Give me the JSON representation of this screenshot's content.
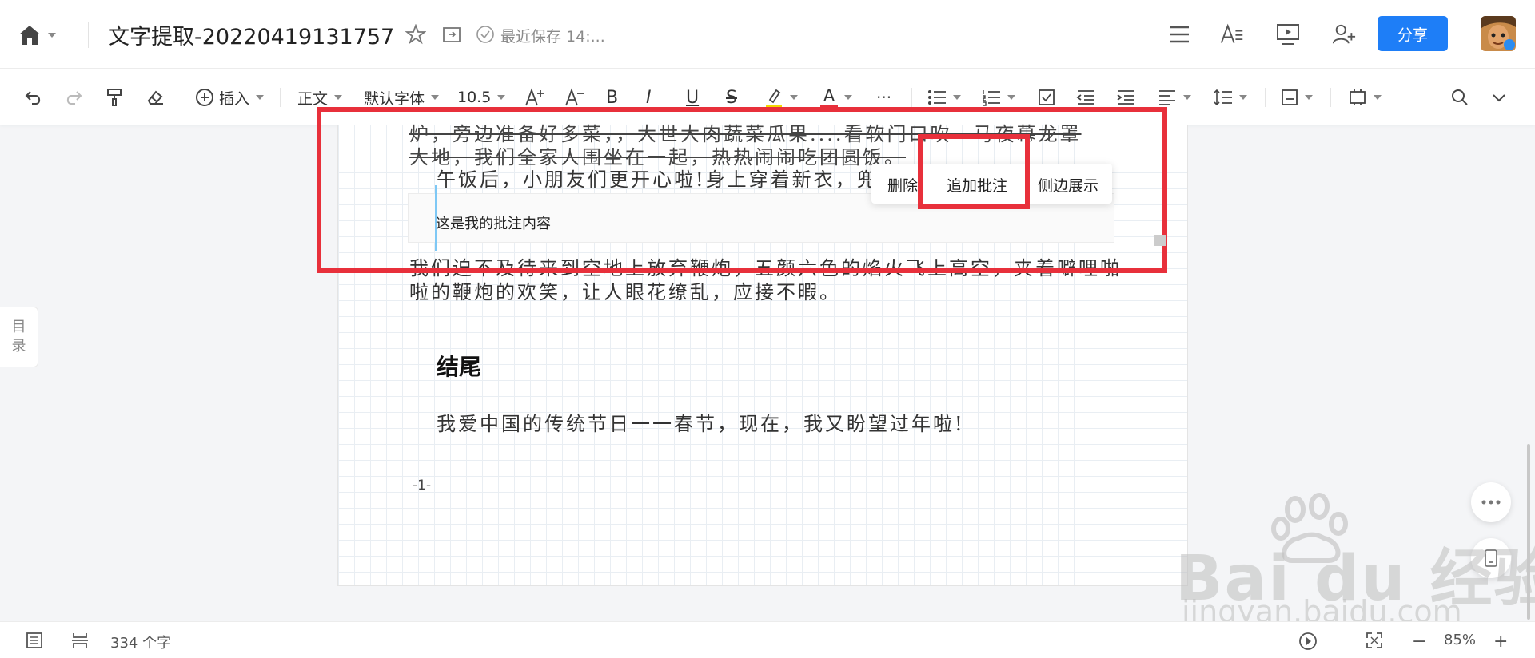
{
  "header": {
    "title": "文字提取-20220419131757",
    "save_status": "最近保存 14:...",
    "share_label": "分享"
  },
  "toolbar": {
    "insert_label": "插入",
    "style_label": "正文",
    "font_label": "默认字体",
    "size_label": "10.5",
    "bold": "B",
    "italic": "I",
    "underline": "U",
    "strike": "S",
    "font_color": "A",
    "more": "···",
    "highlight_color": "#f5d800",
    "font_color_value": "#e8303b"
  },
  "toc_tab": {
    "line1": "目",
    "line2": "录"
  },
  "document": {
    "line_strike_1": "炉，旁边准备好多菜，，大世大肉蔬菜瓜果....看软门口吹一马夜幕龙罩",
    "line_strike_2": "大地，我们全家人围坐在一起，热热闹闹吃团圆饭。",
    "line_3": "午饭后，小朋友们更开心啦!身上穿着新衣，兜",
    "line_4": "我们迫不及待来到空地上放弃鞭炮，五颜六色的焰火飞上高空，夹着噼哩啪",
    "line_5": "啦的鞭炮的欢笑，让人眼花缭乱，应接不暇。",
    "heading": "结尾",
    "closing": "我爱中国的传统节日一一春节，现在，我又盼望过年啦!",
    "page_number": "-1-"
  },
  "comment": {
    "text": "这是我的批注内容"
  },
  "context_menu": {
    "delete": "删除",
    "add_comment": "追加批注",
    "side_show": "侧边展示"
  },
  "watermark": {
    "brand": "Bai  du 经验",
    "url": "jingyan.baidu.com"
  },
  "statusbar": {
    "word_count": "334 个字",
    "zoom": "85%",
    "minus": "−",
    "plus": "+"
  }
}
